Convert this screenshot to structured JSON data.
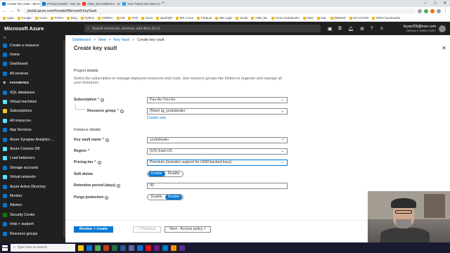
{
  "browser": {
    "tabs": [
      {
        "label": "Create key vault - Microsoft Azu",
        "active": true
      },
      {
        "label": "Pricing Details - Key Vault | Micr",
        "active": false
      },
      {
        "label": "ADB_SecretsDemo - Databricks",
        "active": false
      },
      {
        "label": "Your Tweet has been posted!",
        "active": false
      }
    ],
    "address": "portal.azure.com/#create/Microsoft.KeyVault",
    "bookmarks": [
      "Apps",
      "Google",
      "Azure",
      "POSH",
      "Bing",
      "Python",
      "CDBRA",
      "CB",
      "PSh",
      "Docs",
      "sparklyR",
      "MS Azure",
      "Parquet",
      "DB Login",
      "Scala",
      "ADB_ML",
      "Azure Notebooks",
      "NDA",
      "DaL",
      "DBWork",
      "MA COVID",
      "Other bookmarks"
    ]
  },
  "azure": {
    "brand": "Microsoft Azure",
    "search_placeholder": "Search resources, services, and docs (G+/)",
    "user_name": "bryan256@msn.com",
    "user_directory": "DEFAULT DIRECTORY"
  },
  "sidebar": {
    "items": [
      {
        "label": "Create a resource",
        "color": "#0078d4"
      },
      {
        "label": "Home",
        "color": "#0078d4"
      },
      {
        "label": "Dashboard",
        "color": "#0078d4"
      },
      {
        "label": "All services",
        "color": "#0078d4"
      },
      {
        "label": "FAVORITES",
        "color": "#202020"
      },
      {
        "label": "SQL databases",
        "color": "#0078d4"
      },
      {
        "label": "Virtual machines",
        "color": "#50e6ff"
      },
      {
        "label": "Subscriptions",
        "color": "#f2c811"
      },
      {
        "label": "All resources",
        "color": "#50e6ff"
      },
      {
        "label": "App Services",
        "color": "#0078d4"
      },
      {
        "label": "Azure Synapse Analytics ...",
        "color": "#0078d4"
      },
      {
        "label": "Azure Cosmos DB",
        "color": "#50e6ff"
      },
      {
        "label": "Load balancers",
        "color": "#50e6ff"
      },
      {
        "label": "Storage accounts",
        "color": "#0078d4"
      },
      {
        "label": "Virtual networks",
        "color": "#50e6ff"
      },
      {
        "label": "Azure Active Directory",
        "color": "#0078d4"
      },
      {
        "label": "Monitor",
        "color": "#0078d4"
      },
      {
        "label": "Advisor",
        "color": "#0078d4"
      },
      {
        "label": "Security Center",
        "color": "#107c10"
      },
      {
        "label": "Help + support",
        "color": "#0078d4"
      },
      {
        "label": "Resource groups",
        "color": "#0078d4"
      }
    ]
  },
  "breadcrumb": [
    "Dashboard",
    "New",
    "Key Vault",
    "Create key vault"
  ],
  "page": {
    "title": "Create key vault",
    "project_details": "Project details",
    "project_desc": "Select the subscription to manage deployed resources and costs. Use resource groups like folders to organize and manage all your resources.",
    "subscription_label": "Subscription",
    "subscription_value": "Pay-As-You-Go",
    "resource_group_label": "Resource group",
    "resource_group_value": "(New) rg_youtubeakv",
    "create_new": "Create new",
    "instance_details": "Instance details",
    "vault_name_label": "Key vault name",
    "vault_name_value": "youtubeakv",
    "region_label": "Region",
    "region_value": "(US) East US",
    "pricing_label": "Pricing tier",
    "pricing_value": "Premium (includes support for HSM backed keys)",
    "soft_delete_label": "Soft delete",
    "retention_label": "Retention period (days)",
    "retention_value": "90",
    "purge_label": "Purge protection",
    "enable": "Enable",
    "disable": "Disable"
  },
  "footer": {
    "review_create": "Review + create",
    "previous": "< Previous",
    "next": "Next : Access policy >"
  },
  "taskbar": {
    "search_placeholder": "Type here to search"
  }
}
